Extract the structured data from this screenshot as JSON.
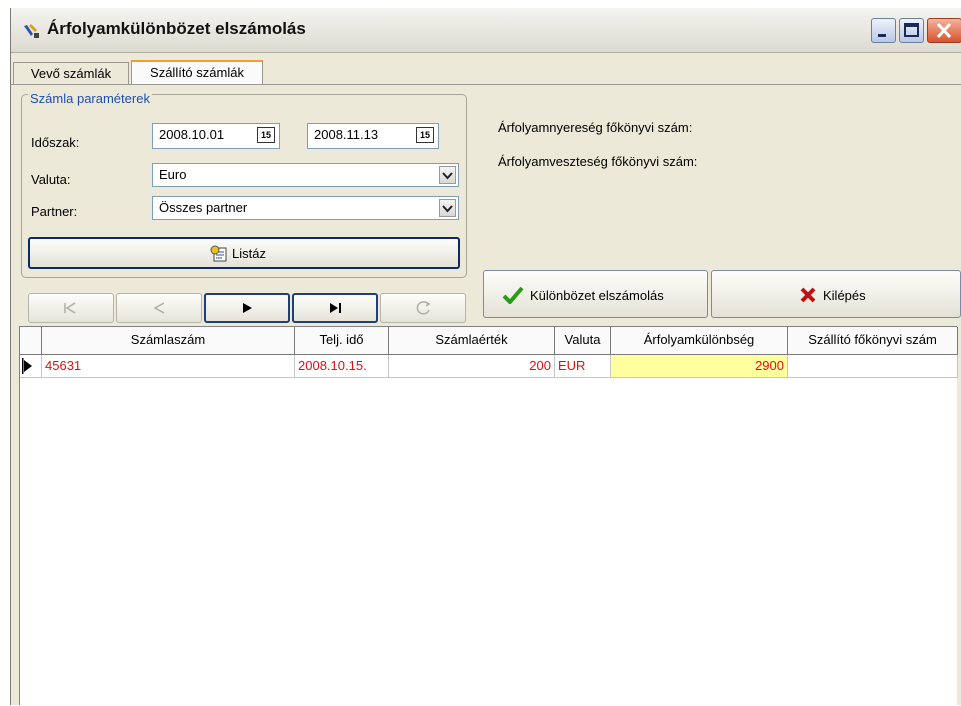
{
  "window": {
    "title": "Árfolyamkülönbözet elszámolás"
  },
  "tabs": [
    {
      "label": "Vevő számlák",
      "active": false
    },
    {
      "label": "Szállító számlák",
      "active": true
    }
  ],
  "params": {
    "legend": "Számla paraméterek",
    "period_label": "Időszak:",
    "date_from": "2008.10.01",
    "date_to": "2008.11.13",
    "calendar_icon_text": "15",
    "currency_label": "Valuta:",
    "currency_value": "Euro",
    "partner_label": "Partner:",
    "partner_value": "Összes partner",
    "list_button": "Listáz"
  },
  "ledger": {
    "gain_label": "Árfolyamnyereség főkönyvi szám:",
    "loss_label": "Árfolyamveszteség főkönyvi szám:"
  },
  "actions": {
    "settle_button": "Különbözet elszámolás",
    "exit_button": "Kilépés"
  },
  "grid": {
    "columns": [
      "Számlaszám",
      "Telj. idő",
      "Számlaérték",
      "Valuta",
      "Árfolyamkülönbség",
      "Szállító főkönyvi szám"
    ],
    "rows": [
      {
        "invoice": "45631",
        "date": "2008.10.15.",
        "value": "200",
        "currency": "EUR",
        "diff": "2900",
        "ledger": ""
      }
    ]
  },
  "colors": {
    "row_text": "#e01010",
    "highlight_cell": "#ffffa0",
    "legend_text": "#1c4fb4",
    "check": "#2a9a1a",
    "cross": "#c01010"
  }
}
